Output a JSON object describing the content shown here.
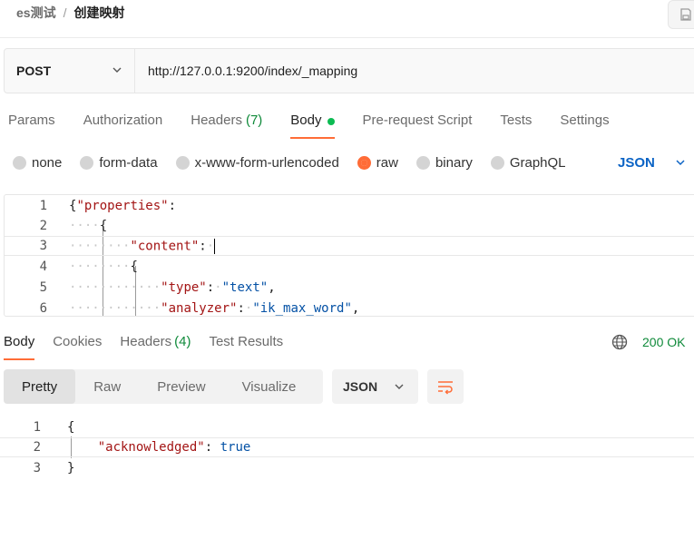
{
  "breadcrumb": {
    "parent": "es测试",
    "separator": "/",
    "current": "创建映射"
  },
  "request": {
    "method": "POST",
    "url": "http://127.0.0.1:9200/index/_mapping"
  },
  "request_tabs": [
    {
      "label": "Params"
    },
    {
      "label": "Authorization"
    },
    {
      "label": "Headers",
      "count": "(7)"
    },
    {
      "label": "Body"
    },
    {
      "label": "Pre-request Script"
    },
    {
      "label": "Tests"
    },
    {
      "label": "Settings"
    }
  ],
  "body_types": [
    "none",
    "form-data",
    "x-www-form-urlencoded",
    "raw",
    "binary",
    "GraphQL"
  ],
  "body_language": "JSON",
  "request_body": {
    "line_numbers": [
      "1",
      "2",
      "3",
      "4",
      "5",
      "6"
    ],
    "l1_brace": "{",
    "l1_key": "\"properties\"",
    "l1_colon": ":",
    "l2_brace": "{",
    "l3_key": "\"content\"",
    "l3_colon": ":",
    "l4_brace": "{",
    "l5_key": "\"type\"",
    "l5_colon": ":",
    "l5_val": "\"text\"",
    "l5_comma": ",",
    "l6_key": "\"analyzer\"",
    "l6_colon": ":",
    "l6_val": "\"ik_max_word\"",
    "l6_comma": ","
  },
  "response_tabs": [
    {
      "label": "Body"
    },
    {
      "label": "Cookies"
    },
    {
      "label": "Headers",
      "count": "(4)"
    },
    {
      "label": "Test Results"
    }
  ],
  "status": "200 OK",
  "view_modes": [
    "Pretty",
    "Raw",
    "Preview",
    "Visualize"
  ],
  "response_format": "JSON",
  "response_body": {
    "line_numbers": [
      "1",
      "2",
      "3"
    ],
    "l1": "{",
    "l2_key": "\"acknowledged\"",
    "l2_colon": ":",
    "l2_val": "true",
    "l3": "}"
  },
  "colors": {
    "accent": "#ff6c37",
    "success": "#0f8a3a",
    "link": "#0b63c5"
  }
}
